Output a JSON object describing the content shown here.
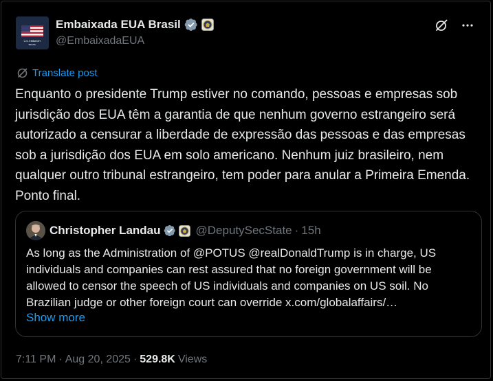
{
  "account": {
    "display_name": "Embaixada EUA Brasil",
    "handle": "@EmbaixadaEUA",
    "avatar_text": "U.S. EMBASSY",
    "avatar_subtext": "BRASIL",
    "avatar_flag_icon": "us-flag",
    "verified_icon": "verified-badge-gray",
    "affiliation_icon": "us-state-department-seal"
  },
  "actions": {
    "grok_icon": "grok-icon",
    "more_icon": "more-options-icon"
  },
  "translate": {
    "label": "Translate post",
    "icon": "translate-icon"
  },
  "post": {
    "text": "Enquanto o presidente Trump estiver no comando, pessoas e empresas sob jurisdição dos EUA têm a garantia de que nenhum governo estrangeiro será autorizado a censurar a liberdade de expressão das pessoas e das empresas sob a jurisdição dos EUA em solo americano. Nenhum juiz brasileiro, nem qualquer outro tribunal estrangeiro, tem poder para anular a Primeira Emenda. Ponto final."
  },
  "quoted_post": {
    "display_name": "Christopher Landau",
    "handle": "@DeputySecState",
    "separator": "·",
    "time": "15h",
    "text": "As long as the Administration of @POTUS @realDonaldTrump is in charge, US individuals and companies can rest assured that no foreign government will be allowed to censor the speech of US individuals and companies on US soil. No Brazilian judge or other foreign court can override x.com/globalaffairs/…",
    "show_more": "Show more"
  },
  "meta": {
    "time": "7:11 PM",
    "sep1": "·",
    "date": "Aug 20, 2025",
    "sep2": "·",
    "views_count": "529.8K",
    "views_label": "Views"
  },
  "colors": {
    "background": "#000000",
    "text": "#e7e9ea",
    "secondary": "#71767b",
    "link": "#1d9bf0",
    "border": "#2f3336",
    "verified_gray": "#829aab"
  }
}
